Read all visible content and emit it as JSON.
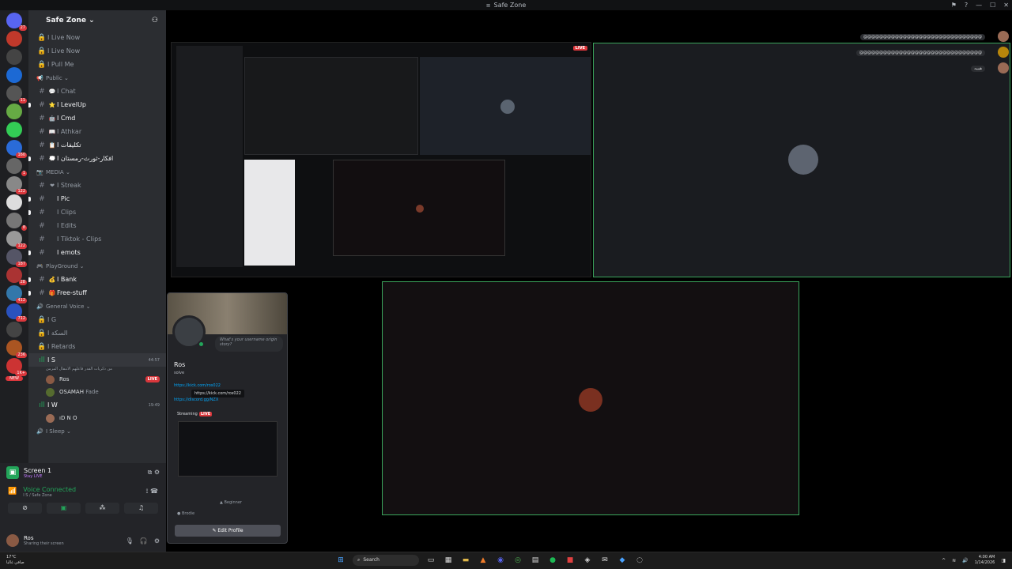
{
  "window": {
    "title": "Safe Zone"
  },
  "server": {
    "name": "Safe Zone"
  },
  "rail_badges": [
    "27",
    "11",
    "160",
    "1",
    "122",
    "8",
    "122",
    "187",
    "28",
    "412",
    "712",
    "236",
    "1K+"
  ],
  "rail_new": "NEW",
  "channels": {
    "top": [
      "I Live Now",
      "I Live Now",
      "I Pull Me"
    ],
    "public_label": "Public",
    "public": [
      "I Chat",
      "I LevelUp",
      "I Cmd",
      "I Athkar",
      "I تكليفات",
      "I افكار-ثورث-رمستان"
    ],
    "media_label": "MEDIA",
    "media": [
      "I Streak",
      "I Pic",
      "I Clips",
      "I Edits",
      "I Tiktok - Clips",
      "I emots"
    ],
    "playground_label": "PlayGround",
    "playground": [
      "I Bank",
      "Free-stuff"
    ],
    "voice_label": "General Voice",
    "voice": [
      "I G",
      "I السكة",
      "I Retards"
    ],
    "active_voice": {
      "name": "I S",
      "timer": "44:57",
      "subtitle": "من ذكريات القدر فاعلهم الانتقال المزمن"
    },
    "voice_users": [
      {
        "name": "Ros",
        "live": "LIVE"
      },
      {
        "name": "OSAMAH",
        "extra": "Fade"
      }
    ],
    "voice2": {
      "name": "I W",
      "timer": "19:49"
    },
    "voice2_users": [
      {
        "name": "ıD N O"
      }
    ],
    "sleep_label": "I Sleep"
  },
  "voice_panel": {
    "screen_name": "Screen 1",
    "screen_sub": "Stay LIVE",
    "connected": "Voice Connected",
    "connected_sub": "I S / Safe Zone",
    "username": "Ros",
    "user_status": "Sharing their screen"
  },
  "stage": {
    "chat_lines": [
      "@@@@@@@@@@@@@@@@@@@@@@@@@@@@@@",
      "@@@@@@@@@@@@@@@@@@@@@@@@@@@@@@@",
      "هيييه"
    ]
  },
  "profile": {
    "bubble": "What's your username origin story?",
    "name": "Ros",
    "tag": "solve",
    "link1": "https://kick.com/ros022",
    "tooltip": "https://kick.com/ros022",
    "link2": "https://discord.gg/NZX",
    "streaming": "Streaming",
    "live": "LIVE",
    "row1": "Beginner",
    "row2": "Brodie",
    "edit": "Edit Profile"
  },
  "taskbar": {
    "temp": "17°C",
    "weather": "صافي غالبا",
    "search": "Search",
    "time": "4:00 AM",
    "date": "1/14/2026"
  }
}
